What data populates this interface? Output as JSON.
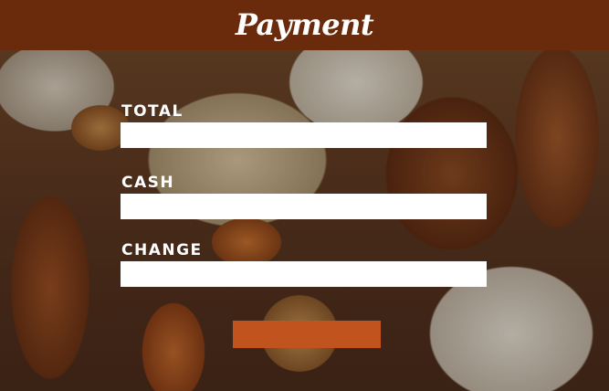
{
  "header": {
    "title": "Payment"
  },
  "form": {
    "total": {
      "label": "TOTAL",
      "value": "",
      "placeholder": ""
    },
    "cash": {
      "label": "CASH",
      "value": "",
      "placeholder": ""
    },
    "change": {
      "label": "CHANGE",
      "value": "",
      "placeholder": ""
    },
    "submit_label": ""
  },
  "colors": {
    "header_bg": "#6a2a0c",
    "button_bg": "#c0531e",
    "field_bg": "#ffffff",
    "label_text": "#ffffff"
  }
}
